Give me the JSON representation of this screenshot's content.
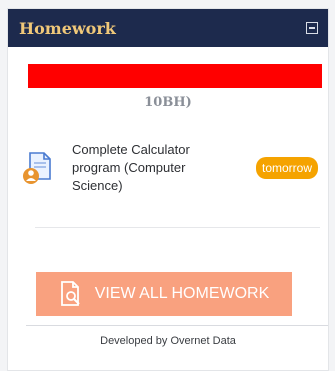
{
  "header": {
    "title": "Homework",
    "collapse_icon": "minus-square-icon"
  },
  "partial_text": "10BH)",
  "homework_items": [
    {
      "title": "Complete Calculator program (Computer Science)",
      "due": "tomorrow",
      "icon": "document-person-icon"
    }
  ],
  "view_all": {
    "label": "VIEW ALL HOMEWORK",
    "icon": "document-search-icon"
  },
  "footer": {
    "credit": "Developed by Overnet Data"
  },
  "colors": {
    "header_bg": "#1d2a4d",
    "header_text": "#f0c879",
    "badge": "#f5a300",
    "button": "#f9a17f",
    "redaction": "#ff0000"
  }
}
